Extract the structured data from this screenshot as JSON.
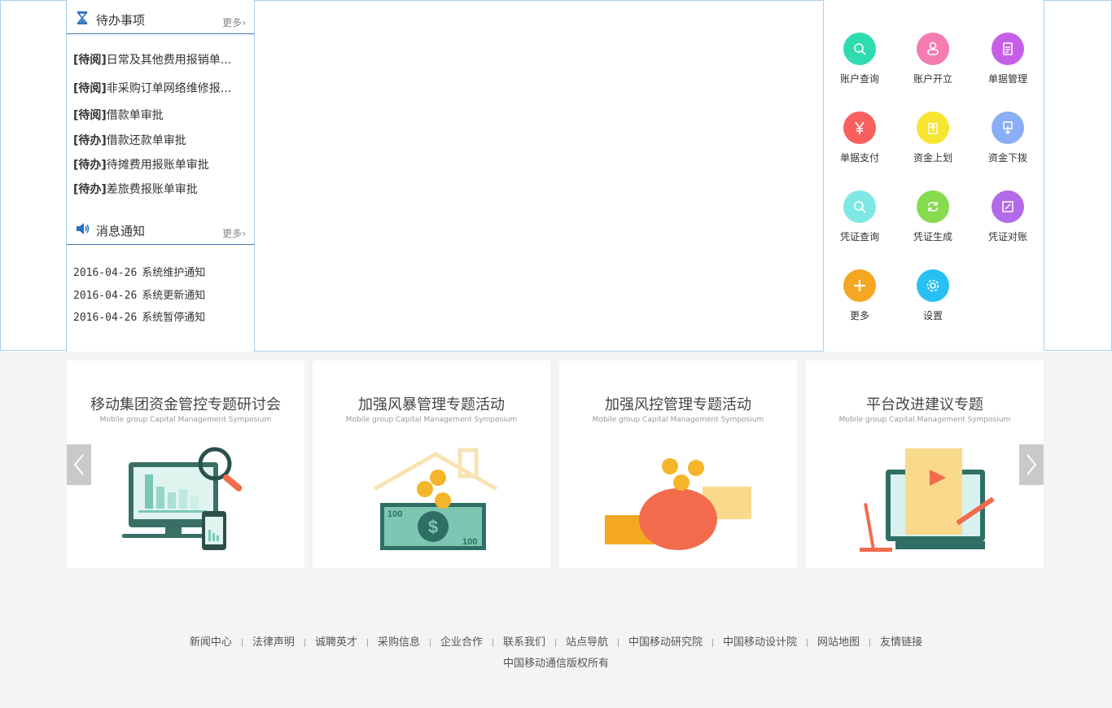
{
  "todo": {
    "title": "待办事项",
    "more": "更多",
    "items": [
      {
        "tag": "[待阅]",
        "text": "日常及其他费用报销单..."
      },
      {
        "tag": "[待阅]",
        "text": "非采购订单网络维修报..."
      },
      {
        "tag": "[待阅]",
        "text": "借款单审批"
      },
      {
        "tag": "[待办]",
        "text": "借款还款单审批"
      },
      {
        "tag": "[待办]",
        "text": "待摊费用报账单审批"
      },
      {
        "tag": "[待办]",
        "text": "差旅费报账单审批"
      }
    ]
  },
  "notice": {
    "title": "消息通知",
    "more": "更多",
    "items": [
      {
        "date": "2016-04-26",
        "text": "系统维护通知"
      },
      {
        "date": "2016-04-26",
        "text": "系统更新通知"
      },
      {
        "date": "2016-04-26",
        "text": "系统暂停通知"
      }
    ]
  },
  "apps": [
    {
      "label": "账户查询",
      "color": "#2fdcaf",
      "icon": "search-account-icon"
    },
    {
      "label": "账户开立",
      "color": "#f57cb0",
      "icon": "user-add-icon"
    },
    {
      "label": "单据管理",
      "color": "#c65fe8",
      "icon": "document-icon"
    },
    {
      "label": "单据支付",
      "color": "#f95f5f",
      "icon": "yen-icon"
    },
    {
      "label": "资金上划",
      "color": "#f7e532",
      "icon": "upload-icon"
    },
    {
      "label": "资金下拨",
      "color": "#8aaef5",
      "icon": "download-icon"
    },
    {
      "label": "凭证查询",
      "color": "#7fe8e4",
      "icon": "voucher-search-icon"
    },
    {
      "label": "凭证生成",
      "color": "#86db4f",
      "icon": "refresh-icon"
    },
    {
      "label": "凭证对账",
      "color": "#b26ae8",
      "icon": "reconcile-icon"
    },
    {
      "label": "更多",
      "color": "#f5a623",
      "icon": "plus-icon"
    },
    {
      "label": "设置",
      "color": "#28c0f2",
      "icon": "gear-icon"
    }
  ],
  "cards": [
    {
      "title": "移动集团资金管控专题研讨会",
      "subtitle": "Mobile group Capital Management Symposium"
    },
    {
      "title": "加强风暴管理专题活动",
      "subtitle": "Mobile group Capital Management Symposium"
    },
    {
      "title": "加强风控管理专题活动",
      "subtitle": "Mobile group Capital Management Symposium"
    },
    {
      "title": "平台改进建议专题",
      "subtitle": "Mobile group Capital Management Symposium"
    }
  ],
  "footer": {
    "links": [
      "新闻中心",
      "法律声明",
      "诚聘英才",
      "采购信息",
      "企业合作",
      "联系我们",
      "站点导航",
      "中国移动研究院",
      "中国移动设计院",
      "网站地图",
      "友情链接"
    ],
    "copyright": "中国移动通信版权所有"
  },
  "bill_labels": {
    "left": "100",
    "right": "100"
  }
}
